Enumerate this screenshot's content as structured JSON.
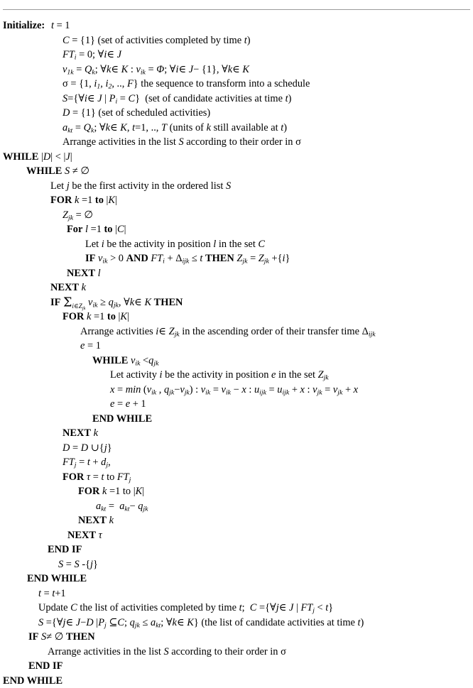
{
  "document": {
    "kind": "algorithm-pseudocode",
    "has_top_rule": true,
    "text_color": "#000000",
    "background_color": "#ffffff"
  },
  "labels": {
    "initialize": "Initialize:"
  },
  "lines": {
    "l01": "t = 1",
    "l02": "C = {1} (set of activities completed by time t)",
    "l03": "FTi = 0; ∀i∈ J",
    "l04": "v1k = Qk; ∀k∈ K : vik = Φ; ∀i∈ J− {1}, ∀k∈ K",
    "l05": "σ = {1, i1, i2, .., F} the sequence to transform into a schedule",
    "l06": "S={∀i∈ J | Pi = C}  (set of candidate activities at time t)",
    "l07": "D = {1} (set of scheduled activities)",
    "l08": "akt = Qk; ∀k∈ K, t=1, .., T (units of k still available at t)",
    "l09": "Arrange activities in the list S according to their order in σ",
    "l10": "WHILE |D| < |J|",
    "l11": "WHILE S ≠ ∅",
    "l12": "Let j be the first activity in the ordered list S",
    "l13": "FOR k =1 to |K|",
    "l14": "Zjk = ∅",
    "l15": "For l =1 to |C|",
    "l16": "Let i be the activity in position l in the set C",
    "l17": "IF vik > 0 AND FTi + Δijk ≤ t THEN Zjk = Zjk +{i}",
    "l18": "NEXT l",
    "l19": "NEXT k",
    "l20": "IF Σi∈Zjk vik ≥ qjk, ∀k∈ K THEN",
    "l21": "FOR k =1 to |K|",
    "l22": "Arrange activities i∈ Zjk in the ascending order of their transfer time Δijk",
    "l23": "e = 1",
    "l24": "WHILE vik <qjk",
    "l25": "Let activity i be the activity in position e in the set Zjk",
    "l26": "x = min (vik , qjk−vjk) : vik = vik − x : uijk = uijk + x : vjk = vjk + x",
    "l27": "e = e + 1",
    "l28": "END WHILE",
    "l29": "NEXT k",
    "l30": "D = D ∪{j}",
    "l31": "FTj = t + dj,",
    "l32": "FOR τ = t to FTj",
    "l33": "FOR k =1 to |K|",
    "l34": "akt =  akt− qjk",
    "l35": "NEXT k",
    "l36": "NEXT τ",
    "l37": "END IF",
    "l38": "S = S -{j}",
    "l39": "END WHILE",
    "l40": "t = t+1",
    "l41": "Update C the list of activities completed by time t;  C ={∀j∈ J | FTj < t}",
    "l42": "S ={∀j∈ J−D |Pj ⊆C; qjk ≤ akt; ∀k∈ K} (the list of candidate activities at time t)",
    "l43": "IF S≠ ∅ THEN",
    "l44": "Arrange activities in the list S according to their order in σ",
    "l45": "END IF",
    "l46": "END WHILE"
  },
  "keywords": {
    "while": "WHILE",
    "end_while": "END WHILE",
    "for_caps": "FOR",
    "for_mixed": "For",
    "next": "NEXT",
    "if": "IF",
    "then": "THEN",
    "and": "AND",
    "end_if": "END IF",
    "to": "to"
  },
  "symbols": {
    "forall": "∀",
    "elementof": "∈",
    "emptyset": "∅",
    "notequal": "≠",
    "lessequal": "≤",
    "greaterequal": "≥",
    "union": "∪",
    "subseteq": "⊆",
    "sigma": "σ",
    "tau": "τ",
    "delta": "Δ",
    "phi": "Φ",
    "sum": "Σ",
    "minus": "−"
  }
}
